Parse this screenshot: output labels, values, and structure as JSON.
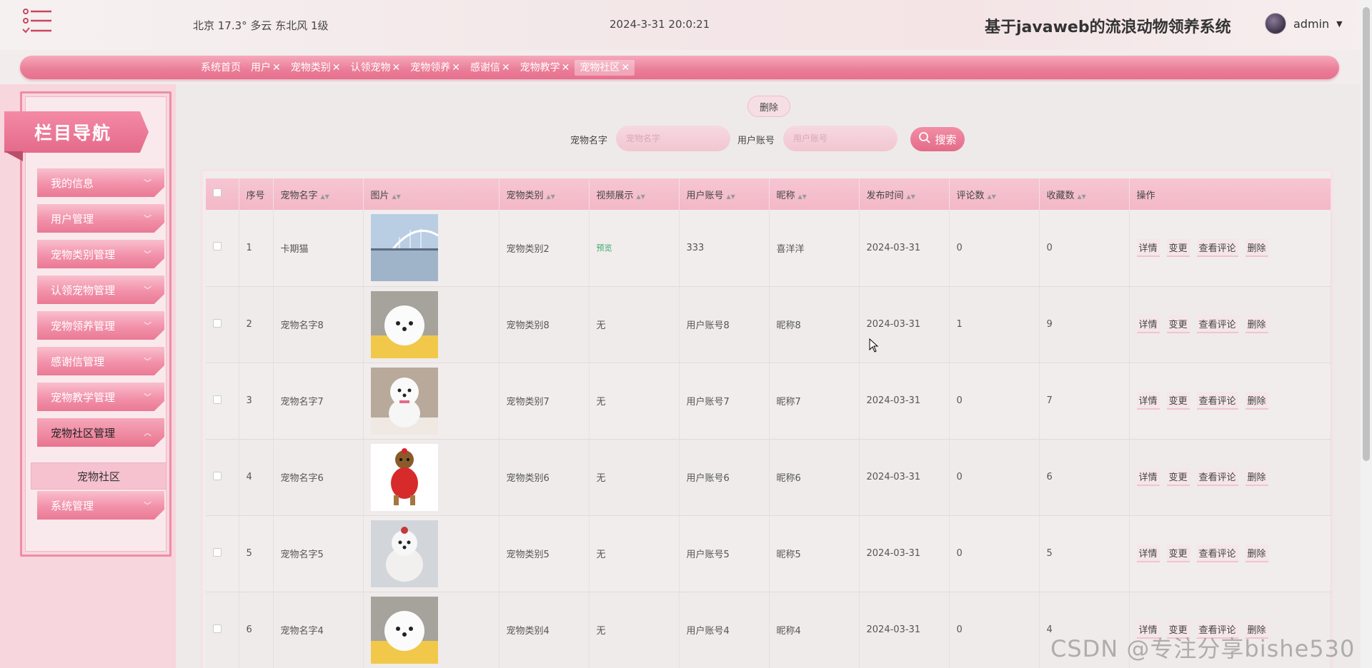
{
  "header": {
    "weather": "北京  17.3°  多云  东北风  1级",
    "datetime": "2024-3-31 20:0:21",
    "title": "基于javaweb的流浪动物领养系统",
    "user": "admin"
  },
  "tabs": [
    {
      "label": "系统首页",
      "closable": false
    },
    {
      "label": "用户",
      "closable": true
    },
    {
      "label": "宠物类别",
      "closable": true
    },
    {
      "label": "认领宠物",
      "closable": true
    },
    {
      "label": "宠物领养",
      "closable": true
    },
    {
      "label": "感谢信",
      "closable": true
    },
    {
      "label": "宠物教学",
      "closable": true
    },
    {
      "label": "宠物社区",
      "closable": true,
      "active": true
    }
  ],
  "close_glyph": "✕",
  "sidebar": {
    "title": "栏目导航",
    "items": [
      "我的信息",
      "用户管理",
      "宠物类别管理",
      "认领宠物管理",
      "宠物领养管理",
      "感谢信管理",
      "宠物教学管理",
      "宠物社区管理",
      "系统管理"
    ],
    "open_item": "宠物社区管理",
    "sub_item": "宠物社区"
  },
  "toolbar": {
    "delete_label": "删除",
    "pet_name_label": "宠物名字",
    "pet_name_placeholder": "宠物名字",
    "account_label": "用户账号",
    "account_placeholder": "用户账号",
    "search_label": "搜索"
  },
  "table": {
    "columns": [
      "序号",
      "宠物名字",
      "图片",
      "宠物类别",
      "视频展示",
      "用户账号",
      "昵称",
      "发布时间",
      "评论数",
      "收藏数",
      "操作"
    ],
    "rows": [
      {
        "no": "1",
        "name": "卡期猫",
        "image": "bridge-lake",
        "category": "宠物类别2",
        "video": "预览",
        "account": "333",
        "nickname": "喜洋洋",
        "time": "2024-03-31",
        "comments": "0",
        "favorites": "0"
      },
      {
        "no": "2",
        "name": "宠物名字8",
        "image": "white-pom",
        "category": "宠物类别8",
        "video": "无",
        "account": "用户账号8",
        "nickname": "昵称8",
        "time": "2024-03-31",
        "comments": "1",
        "favorites": "9"
      },
      {
        "no": "3",
        "name": "宠物名字7",
        "image": "white-pom-sitting",
        "category": "宠物类别7",
        "video": "无",
        "account": "用户账号7",
        "nickname": "昵称7",
        "time": "2024-03-31",
        "comments": "0",
        "favorites": "7"
      },
      {
        "no": "4",
        "name": "宠物名字6",
        "image": "yorkie-red-sweater",
        "category": "宠物类别6",
        "video": "无",
        "account": "用户账号6",
        "nickname": "昵称6",
        "time": "2024-03-31",
        "comments": "0",
        "favorites": "6"
      },
      {
        "no": "5",
        "name": "宠物名字5",
        "image": "white-dog-bow",
        "category": "宠物类别5",
        "video": "无",
        "account": "用户账号5",
        "nickname": "昵称5",
        "time": "2024-03-31",
        "comments": "0",
        "favorites": "5"
      },
      {
        "no": "6",
        "name": "宠物名字4",
        "image": "white-pom",
        "category": "宠物类别4",
        "video": "无",
        "account": "用户账号4",
        "nickname": "昵称4",
        "time": "2024-03-31",
        "comments": "0",
        "favorites": "4"
      }
    ],
    "actions": [
      "详情",
      "变更",
      "查看评论",
      "删除"
    ]
  },
  "watermark": "CSDN @专注分享bishe530",
  "colors": {
    "accent": "#e8728e",
    "accent_light": "#f6c6d2",
    "preview_green": "#3aa76a"
  }
}
